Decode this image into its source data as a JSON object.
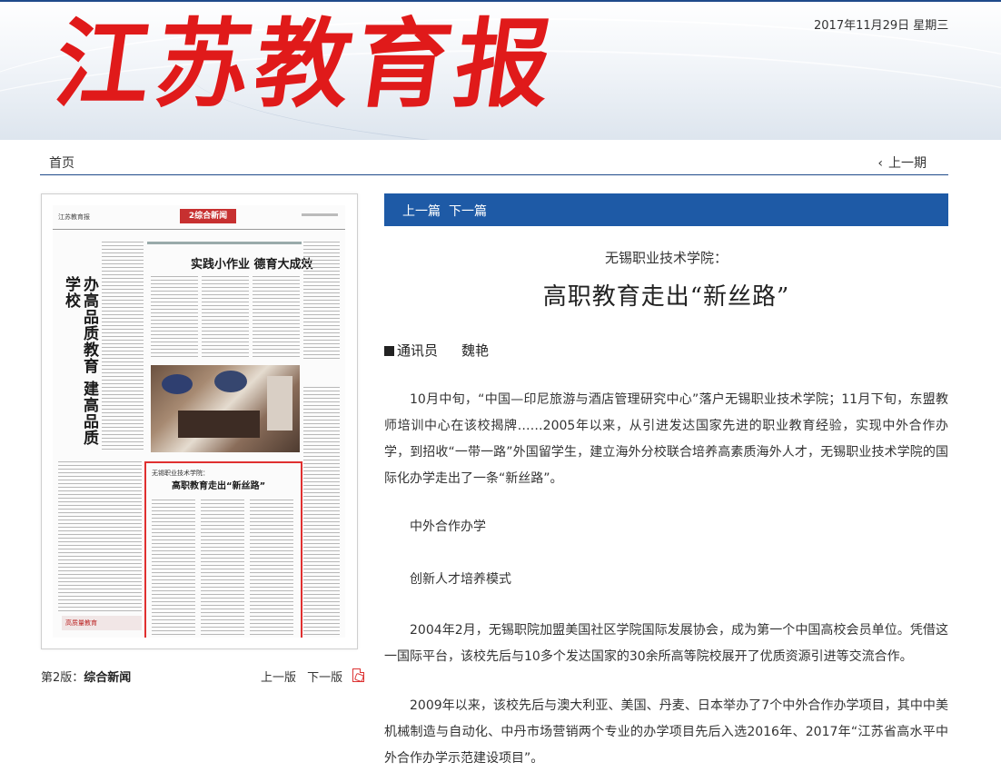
{
  "masthead": {
    "logo_chars": [
      "江",
      "苏",
      "教",
      "育",
      "报"
    ],
    "date": "2017年11月29日 星期三",
    "brand_color": "#e01a1a"
  },
  "nav": {
    "home": "首页",
    "prev_issue": "上一期"
  },
  "thumbnail": {
    "brand": "江苏教育报",
    "section_badge": "2综合新闻",
    "vertical_title": "办高品质教育 建高品质学校",
    "headline": "实践小作业 德育大成效",
    "article_kicker": "无锡职业技术学院：",
    "article_title": "高职教育走出“新丝路”",
    "footer_mark": "高质量教育"
  },
  "edition": {
    "label_prefix": "第2版：",
    "label_name": "综合新闻",
    "prev": "上一版",
    "next": "下一版"
  },
  "article": {
    "prev": "上一篇",
    "next": "下一篇",
    "kicker": "无锡职业技术学院：",
    "title": "高职教育走出“新丝路”",
    "byline_role": "通讯员",
    "byline_name": "魏艳",
    "para1": "10月中旬，“中国—印尼旅游与酒店管理研究中心”落户无锡职业技术学院；11月下旬，东盟教师培训中心在该校揭牌……2005年以来，从引进发达国家先进的职业教育经验，实现中外合作办学，到招收“一带一路”外国留学生，建立海外分校联合培养高素质海外人才，无锡职业技术学院的国际化办学走出了一条“新丝路”。",
    "sub1": "中外合作办学",
    "sub2": "创新人才培养模式",
    "para2": "2004年2月，无锡职院加盟美国社区学院国际发展协会，成为第一个中国高校会员单位。凭借这一国际平台，该校先后与10多个发达国家的30余所高等院校展开了优质资源引进等交流合作。",
    "para3": "2009年以来，该校先后与澳大利亚、美国、丹麦、日本举办了7个中外合作办学项目，其中中美机械制造与自动化、中丹市场营销两个专业的办学项目先后入选2016年、2017年“江苏省高水平中外合作办学示范建设项目”。",
    "accent_color": "#1e5aa6"
  }
}
